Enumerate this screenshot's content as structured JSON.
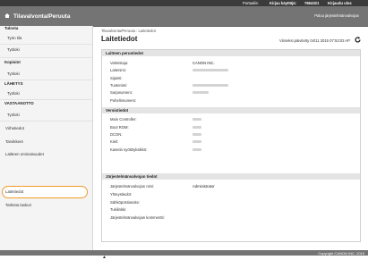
{
  "topbar": {
    "portal": "Portaaliin",
    "login_user": "Kirjau käyttäjä:",
    "user_id": "7654321",
    "logout": "Kirjaudu ulos"
  },
  "header": {
    "title": "Tilavalvonta/Peruuta",
    "admin_link": "Paluu järjestelmänvalvojan"
  },
  "sidebar": {
    "sections": [
      {
        "title": "Tulosta",
        "items": [
          "Työn tila",
          "Työloki"
        ]
      },
      {
        "title": "Kopioint",
        "items": [
          "Työloki"
        ]
      },
      {
        "title": "LÄHETYS",
        "items": [
          "Työloki"
        ]
      },
      {
        "title": "VASTAANOTTO",
        "items": [
          "Työloki"
        ]
      }
    ],
    "extra_items": [
      "Virhetiedot",
      "Tarvikkeet",
      "Laitteen ominaisuudet",
      "Laitetiedot",
      "Tarkista laskuri"
    ]
  },
  "main": {
    "breadcrumb": "Tilavalvonta/Peruuta : Laitetiedot",
    "page_title": "Laitetiedot",
    "updated": "Viimeksi päivitetty 04/11 2015 07:53:03 AP",
    "sections": {
      "perus": {
        "title": "Laitteen perustiedot",
        "rows": [
          {
            "label": "Valmistaja:",
            "value": "CANON INC."
          },
          {
            "label": "Laitenimi:",
            "value": ""
          },
          {
            "label": "Sijainti:",
            "value": ""
          },
          {
            "label": "Tuotenimi:",
            "value": ""
          },
          {
            "label": "Sarjanumero:",
            "value": ""
          },
          {
            "label": "Puhelinnumero:",
            "value": ""
          }
        ]
      },
      "versio": {
        "title": "Versiotiedot",
        "rows": [
          {
            "label": "Main Controller:",
            "value": ""
          },
          {
            "label": "Boot ROM:",
            "value": ""
          },
          {
            "label": "DCON:",
            "value": ""
          },
          {
            "label": "Kieli:",
            "value": ""
          },
          {
            "label": "Kasetin syöttöyksikkö:",
            "value": ""
          }
        ]
      },
      "admin": {
        "title": "Järjestelmänvalvojan tiedot",
        "rows": [
          {
            "label": "Järjestelmänvalvojan nimi:",
            "value": "Administrator"
          },
          {
            "label": "Yhteystiedot:",
            "value": ""
          },
          {
            "label": "Sähköpostiosoite:",
            "value": ""
          },
          {
            "label": "Tukilinkki:",
            "value": ""
          },
          {
            "label": "Järjestelmänvalvojan kommentti:",
            "value": ""
          }
        ]
      }
    },
    "top_link": "▲"
  },
  "footer": {
    "copyright": "Copyright CANON INC. 2015"
  },
  "colors": {
    "header": "#747474",
    "topbar": "#3b3b3b",
    "active_outline": "#f39a2a"
  }
}
